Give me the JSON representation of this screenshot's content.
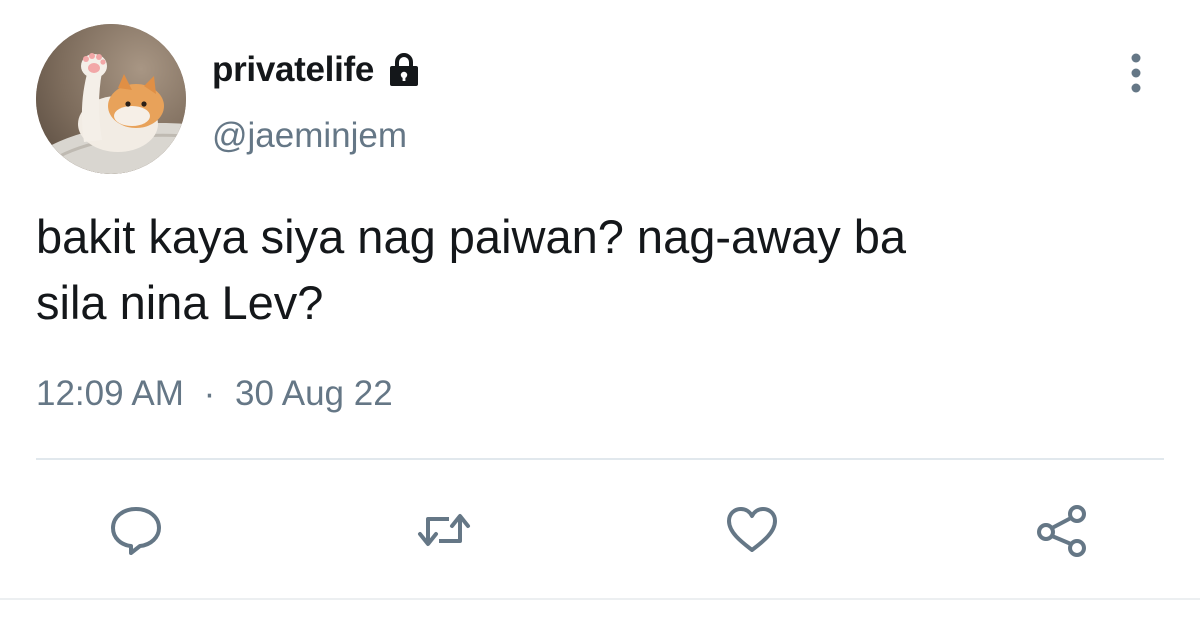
{
  "author": {
    "display_name": "privatelife",
    "handle": "@jaeminjem",
    "protected_icon": "lock-icon",
    "avatar": "cat-waving-paw-avatar"
  },
  "tweet": {
    "text_line1": "bakit kaya siya nag paiwan? nag-away ba",
    "text_line2": "sila nina Lev?",
    "time": "12:09 AM",
    "separator": "·",
    "date": "30 Aug 22"
  },
  "actions": [
    {
      "icon": "reply-icon"
    },
    {
      "icon": "retweet-icon"
    },
    {
      "icon": "like-icon"
    },
    {
      "icon": "share-icon"
    }
  ],
  "menu_icon": "more-vertical-icon",
  "colors": {
    "text": "#14171a",
    "secondary": "#657786",
    "divider": "#e1e8ed"
  }
}
